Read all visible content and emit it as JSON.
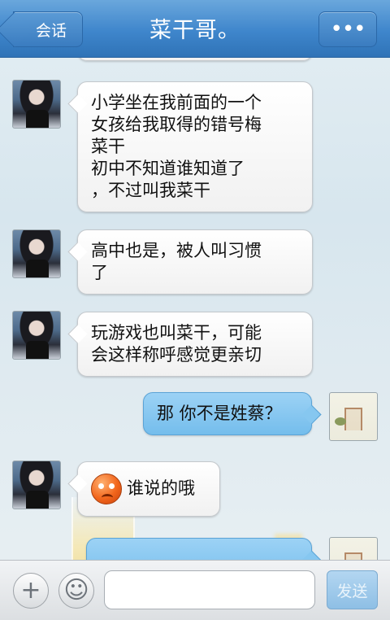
{
  "header": {
    "back_label": "会话",
    "title": "菜干哥。",
    "menu_icon": "ellipsis-icon",
    "menu_label": "•••"
  },
  "messages": [
    {
      "from": "friend",
      "lines": [
        "小学坐在我前面的一个",
        "女孩给我取得的错号梅",
        "菜干",
        "初中不知道谁知道了",
        "，不过叫我菜干"
      ]
    },
    {
      "from": "friend",
      "lines": [
        "高中也是，被人叫习惯",
        "了"
      ]
    },
    {
      "from": "friend",
      "lines": [
        "玩游戏也叫菜干，可能",
        "会这样称呼感觉更亲切"
      ]
    },
    {
      "from": "me",
      "lines": [
        "那 你不是姓蔡？"
      ]
    },
    {
      "from": "friend",
      "emoji": "angry-face-emoji",
      "lines": [
        "谁说的哦"
      ]
    }
  ],
  "input": {
    "value": "",
    "placeholder": ""
  },
  "toolbar": {
    "plus_icon": "plus-icon",
    "plus_label": "+",
    "emoji_icon": "smiley-icon",
    "emoji_label": "☺",
    "send_label": "发送"
  },
  "colors": {
    "header": "#3f86cc",
    "bubble_me": "#86c7f0",
    "bubble_friend": "#ffffff"
  }
}
